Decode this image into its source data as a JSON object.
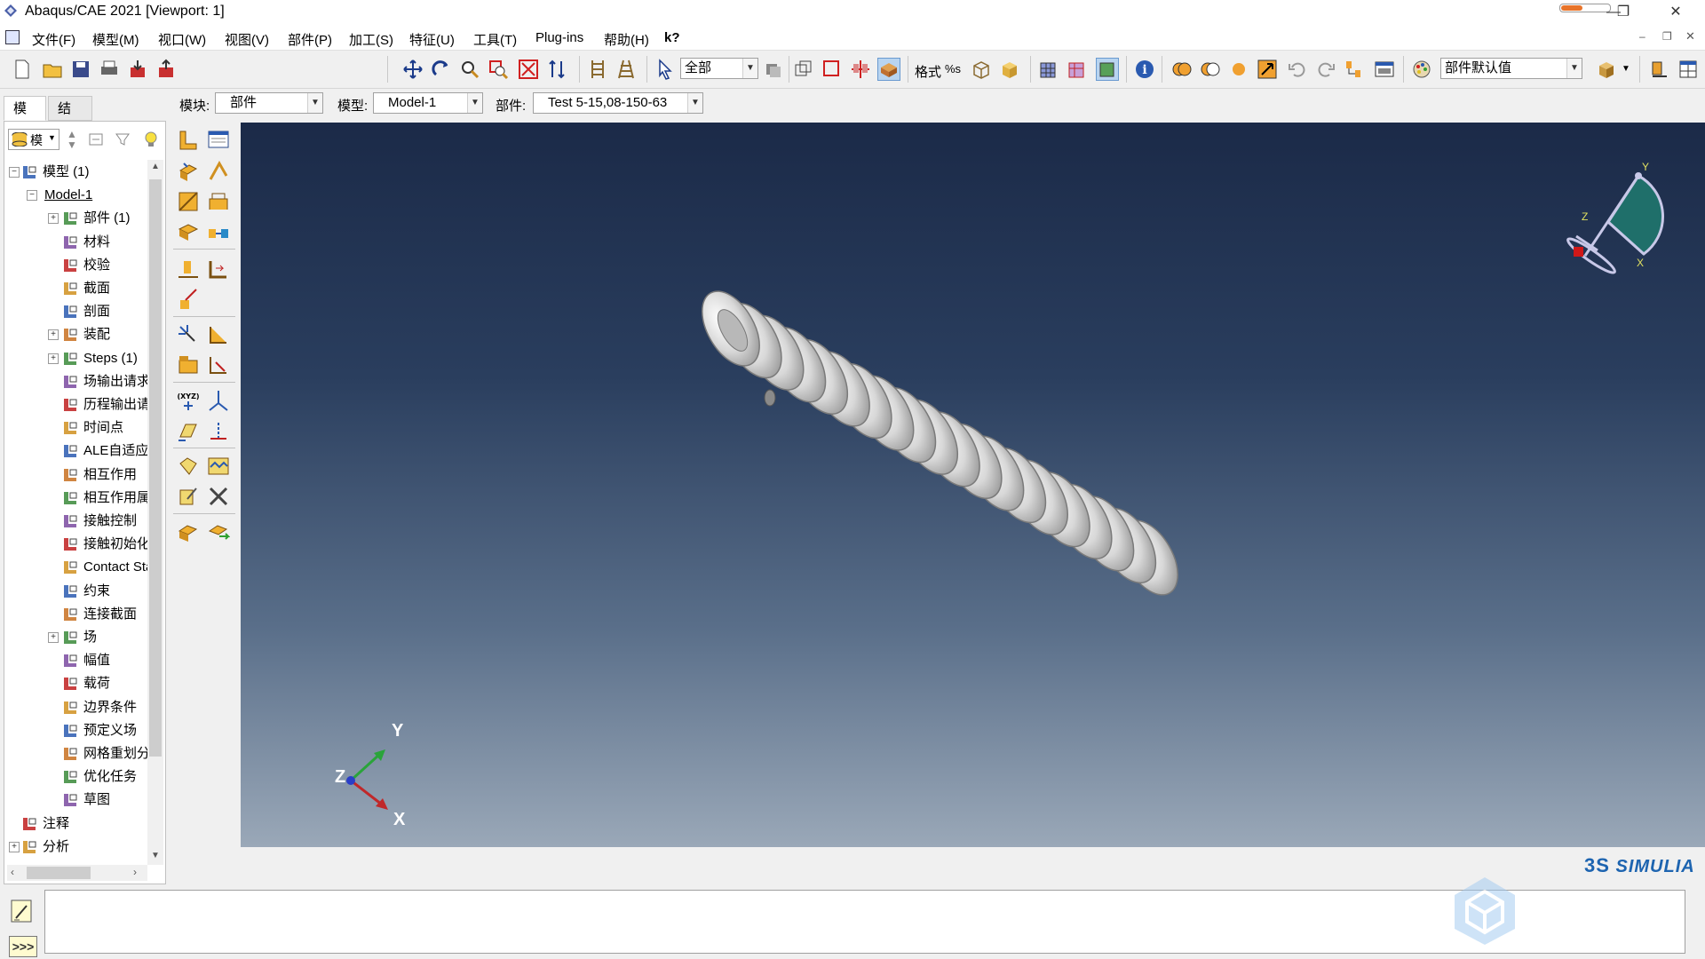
{
  "window": {
    "title": "Abaqus/CAE 2021 [Viewport: 1]"
  },
  "menu": [
    {
      "label": "文件(F)"
    },
    {
      "label": "模型(M)"
    },
    {
      "label": "视口(W)"
    },
    {
      "label": "视图(V)"
    },
    {
      "label": "部件(P)"
    },
    {
      "label": "加工(S)"
    },
    {
      "label": "特征(U)"
    },
    {
      "label": "工具(T)"
    },
    {
      "label": "Plug-ins"
    },
    {
      "label": "帮助(H)"
    },
    {
      "label": "k?"
    }
  ],
  "toolbar": {
    "selection_filter": "全部",
    "render_style_label": "格式",
    "render_style_value": "%s",
    "color_scheme": "部件默认值"
  },
  "context": {
    "module_label": "模块:",
    "module_value": "部件",
    "model_label": "模型:",
    "model_value": "Model-1",
    "part_label": "部件:",
    "part_value": "Test 5-15,08-150-63"
  },
  "tabs": [
    {
      "label": "模型",
      "active": true
    },
    {
      "label": "结果",
      "active": false
    }
  ],
  "tree_filter": "模",
  "tree": [
    {
      "label": "模型 (1)",
      "level": 0,
      "expander": "−",
      "icon": "models-icon"
    },
    {
      "label": "Model-1",
      "level": 1,
      "expander": "−",
      "icon": "",
      "underline": true
    },
    {
      "label": "部件 (1)",
      "level": 2,
      "expander": "+",
      "icon": "parts-icon"
    },
    {
      "label": "材料",
      "level": 2,
      "expander": "",
      "icon": "materials-icon"
    },
    {
      "label": "校验",
      "level": 2,
      "expander": "",
      "icon": "calibrations-icon"
    },
    {
      "label": "截面",
      "level": 2,
      "expander": "",
      "icon": "sections-icon"
    },
    {
      "label": "剖面",
      "level": 2,
      "expander": "",
      "icon": "profiles-icon"
    },
    {
      "label": "装配",
      "level": 2,
      "expander": "+",
      "icon": "assembly-icon"
    },
    {
      "label": "Steps (1)",
      "level": 2,
      "expander": "+",
      "icon": "steps-icon"
    },
    {
      "label": "场输出请求",
      "level": 2,
      "expander": "",
      "icon": "field-output-icon"
    },
    {
      "label": "历程输出请求",
      "level": 2,
      "expander": "",
      "icon": "history-output-icon"
    },
    {
      "label": "时间点",
      "level": 2,
      "expander": "",
      "icon": "time-points-icon"
    },
    {
      "label": "ALE自适应",
      "level": 2,
      "expander": "",
      "icon": "ale-icon"
    },
    {
      "label": "相互作用",
      "level": 2,
      "expander": "",
      "icon": "interactions-icon"
    },
    {
      "label": "相互作用属性",
      "level": 2,
      "expander": "",
      "icon": "interaction-props-icon"
    },
    {
      "label": "接触控制",
      "level": 2,
      "expander": "",
      "icon": "contact-controls-icon"
    },
    {
      "label": "接触初始化",
      "level": 2,
      "expander": "",
      "icon": "contact-init-icon"
    },
    {
      "label": "Contact Stabilizations",
      "level": 2,
      "expander": "",
      "icon": "contact-stab-icon"
    },
    {
      "label": "约束",
      "level": 2,
      "expander": "",
      "icon": "constraints-icon"
    },
    {
      "label": "连接截面",
      "level": 2,
      "expander": "",
      "icon": "connector-sections-icon"
    },
    {
      "label": "场",
      "level": 2,
      "expander": "+",
      "icon": "fields-icon"
    },
    {
      "label": "幅值",
      "level": 2,
      "expander": "",
      "icon": "amplitudes-icon"
    },
    {
      "label": "载荷",
      "level": 2,
      "expander": "",
      "icon": "loads-icon"
    },
    {
      "label": "边界条件",
      "level": 2,
      "expander": "",
      "icon": "bcs-icon"
    },
    {
      "label": "预定义场",
      "level": 2,
      "expander": "",
      "icon": "predefined-fields-icon"
    },
    {
      "label": "网格重划分规则",
      "level": 2,
      "expander": "",
      "icon": "remeshing-icon"
    },
    {
      "label": "优化任务",
      "level": 2,
      "expander": "",
      "icon": "optimization-icon"
    },
    {
      "label": "草图",
      "level": 2,
      "expander": "",
      "icon": "sketches-icon"
    },
    {
      "label": "注释",
      "level": 0,
      "expander": "",
      "icon": "annotations-icon"
    },
    {
      "label": "分析",
      "level": 0,
      "expander": "+",
      "icon": "analysis-icon"
    }
  ],
  "triad": {
    "x": "X",
    "y": "Y",
    "z": "Z"
  },
  "brand": "SIMULIA",
  "colors": {
    "viewport_top": "#1b2a48",
    "viewport_bottom": "#9aa8b8",
    "axis_x": "#c0282a",
    "axis_y": "#2aa43a",
    "axis_z": "#2a3ec8",
    "brand": "#1d64b0",
    "compass_fill": "#1f6f6a"
  }
}
